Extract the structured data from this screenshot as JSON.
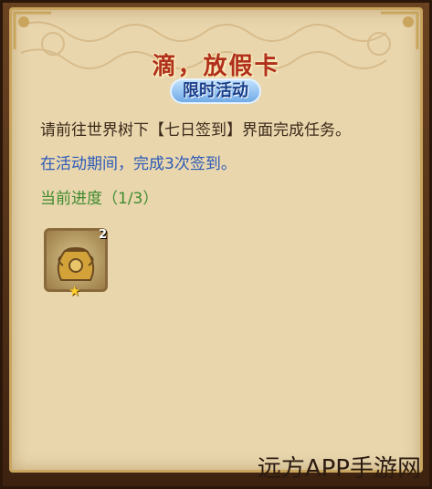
{
  "title": "滴，放假卡",
  "subtitle": "限时活动",
  "task_text": "请前往世界树下【七日签到】界面完成任务。",
  "activity_text": "在活动期间，完成3次签到。",
  "progress_text": "当前进度（1/3）",
  "progress": {
    "current": 1,
    "total": 3
  },
  "reward": {
    "icon": "jar-icon",
    "count": "2",
    "star": "★"
  },
  "watermark": "远方APP手游网",
  "colors": {
    "title": "#b0301b",
    "activity": "#2c5ab8",
    "progress": "#3f8a2e",
    "panel": "#e9d6ad"
  }
}
